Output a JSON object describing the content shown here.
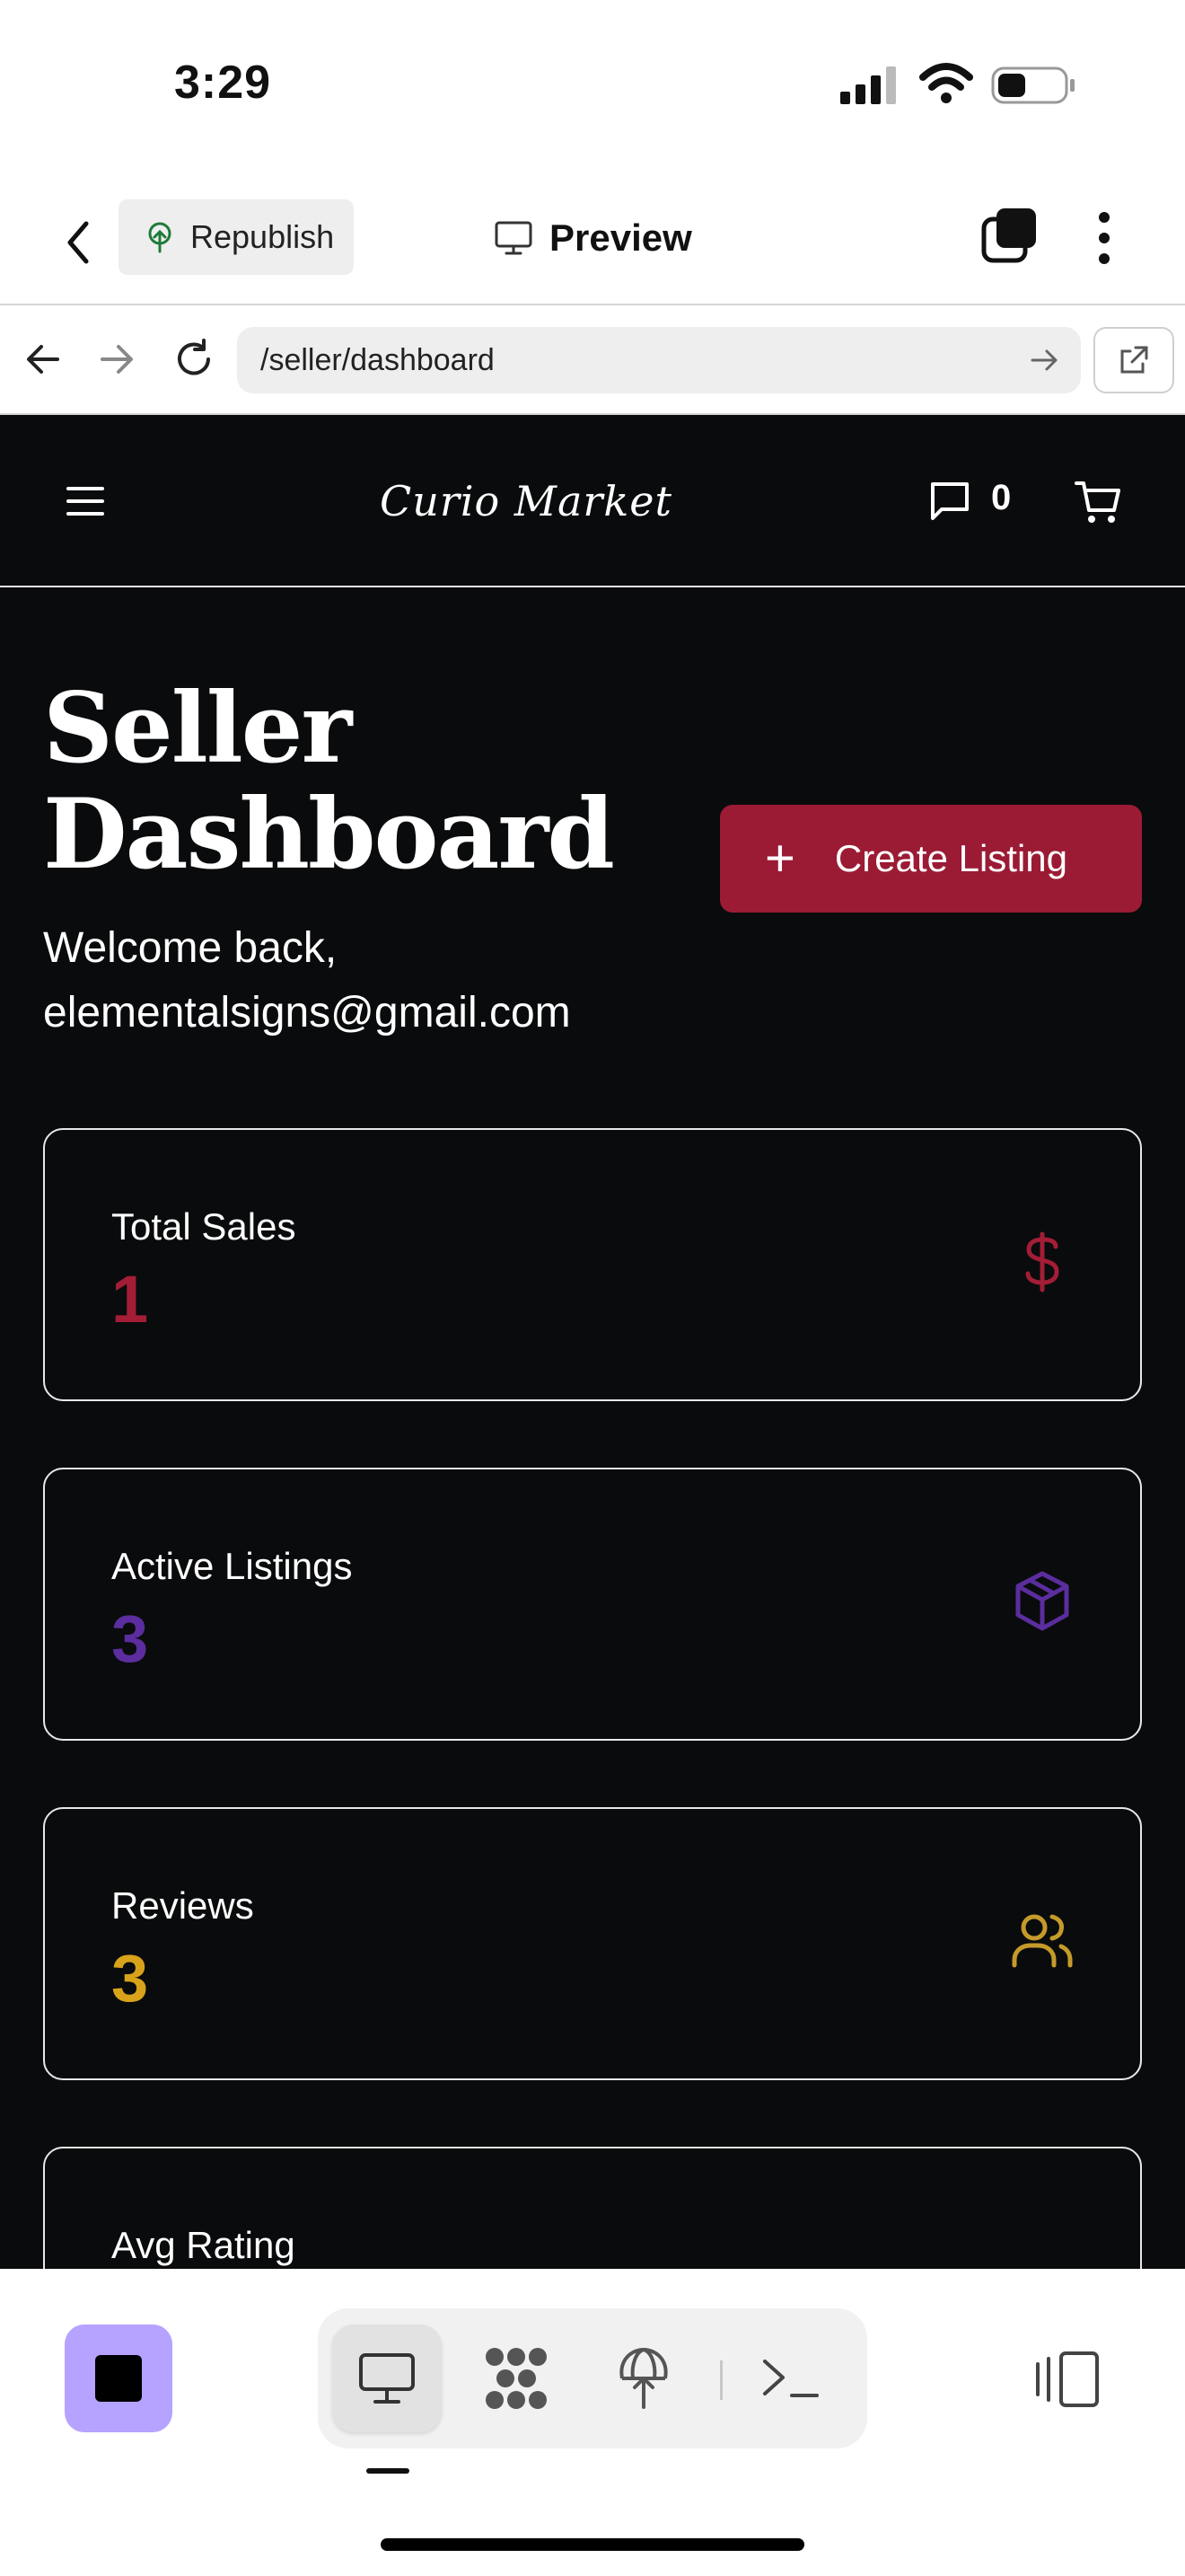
{
  "status_bar": {
    "time": "3:29"
  },
  "toolbar": {
    "republish_label": "Republish",
    "preview_label": "Preview"
  },
  "url_bar": {
    "url": "/seller/dashboard"
  },
  "site": {
    "logo_text": "Curio Market",
    "message_count": "0"
  },
  "dashboard": {
    "title": "Seller Dashboard",
    "welcome_line1": "Welcome back,",
    "welcome_line2": "elementalsigns@gmail.com",
    "create_listing_label": "Create Listing",
    "stats": [
      {
        "label": "Total Sales",
        "value": "1",
        "color": "#a31d36",
        "icon": "dollar-icon"
      },
      {
        "label": "Active Listings",
        "value": "3",
        "color": "#5b2d9e",
        "icon": "package-icon"
      },
      {
        "label": "Reviews",
        "value": "3",
        "color": "#d9a21b",
        "icon": "users-icon"
      },
      {
        "label": "Avg Rating",
        "value": "",
        "color": "#ffffff",
        "icon": ""
      }
    ]
  },
  "colors": {
    "page_bg": "#0a0b0c",
    "accent": "#9b1b35",
    "stop_button": "#b6a3ff"
  },
  "dock": {
    "items": [
      "monitor-icon",
      "extensions-icon",
      "deploy-icon",
      "terminal-icon"
    ],
    "active": "monitor-icon"
  }
}
